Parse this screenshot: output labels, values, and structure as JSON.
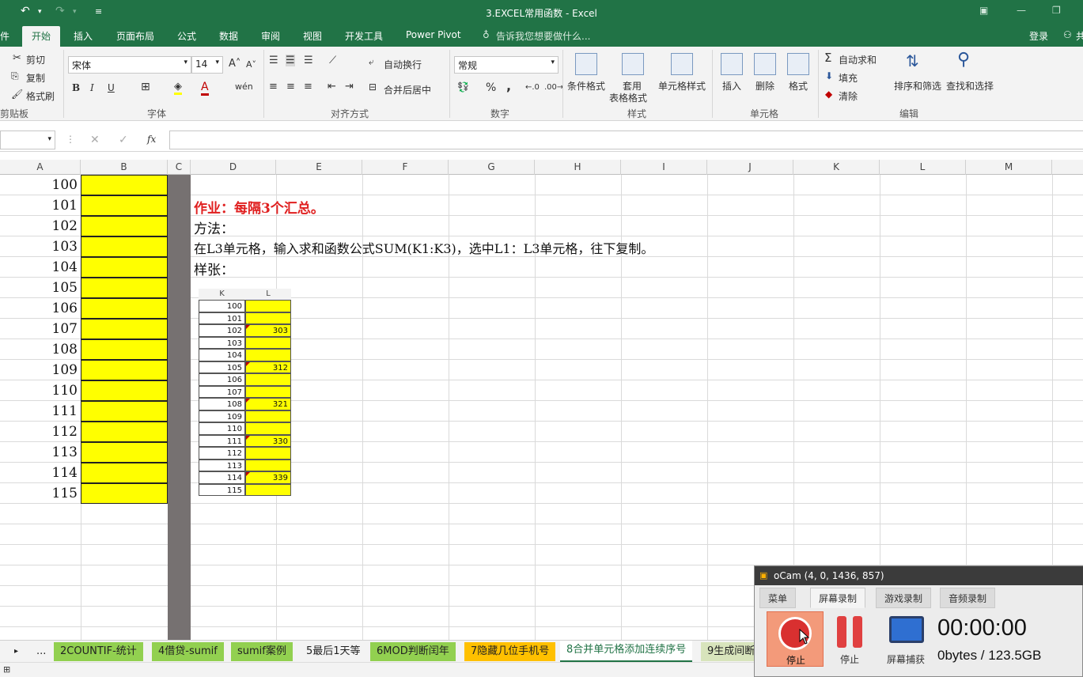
{
  "titlebar": {
    "title": "3.EXCEL常用函数 - Excel"
  },
  "menu": {
    "file": "件",
    "home": "开始",
    "insert": "插入",
    "layout": "页面布局",
    "formulas": "公式",
    "data": "数据",
    "review": "审阅",
    "view": "视图",
    "developer": "开发工具",
    "powerpivot": "Power Pivot",
    "tellme": "告诉我您想要做什么...",
    "login": "登录",
    "share": "共"
  },
  "ribbon": {
    "clipboard": {
      "cut": "剪切",
      "copy": "复制",
      "painter": "格式刷",
      "label": "剪贴板"
    },
    "font": {
      "name": "宋体",
      "size": "14",
      "bold": "B",
      "italic": "I",
      "underline": "U",
      "label": "字体"
    },
    "align": {
      "wrap": "自动换行",
      "merge": "合并后居中",
      "label": "对齐方式"
    },
    "number": {
      "format": "常规",
      "percent": "%",
      "comma": ",",
      "label": "数字"
    },
    "styles": {
      "cond": "条件格式",
      "table1": "套用",
      "table2": "表格格式",
      "cell": "单元格样式",
      "label": "样式"
    },
    "cells": {
      "insert": "插入",
      "delete": "删除",
      "format": "格式",
      "label": "单元格"
    },
    "edit": {
      "autosum": "自动求和",
      "fill": "填充",
      "clear": "清除",
      "sort": "排序和筛选",
      "find": "查找和选择",
      "label": "编辑"
    }
  },
  "formula": {
    "namebox": "",
    "fx": "fx",
    "cancel": "✕",
    "enter": "✓"
  },
  "columns": [
    "A",
    "B",
    "C",
    "D",
    "E",
    "F",
    "G",
    "H",
    "I",
    "J",
    "K",
    "L",
    "M"
  ],
  "colA": [
    "100",
    "101",
    "102",
    "103",
    "104",
    "105",
    "106",
    "107",
    "108",
    "109",
    "110",
    "111",
    "112",
    "113",
    "114",
    "115"
  ],
  "text": {
    "homework": "作业：每隔3个汇总。",
    "method": "方法：",
    "instr": "在L3单元格，输入求和函数公式SUM(K1:K3)，选中L1：L3单元格，往下复制。",
    "sample": "样张："
  },
  "sample": {
    "hk": "K",
    "hl": "L",
    "k": [
      "100",
      "101",
      "102",
      "103",
      "104",
      "105",
      "106",
      "107",
      "108",
      "109",
      "110",
      "111",
      "112",
      "113",
      "114",
      "115"
    ],
    "l": [
      "",
      "",
      "303",
      "",
      "",
      "312",
      "",
      "",
      "321",
      "",
      "",
      "330",
      "",
      "",
      "339",
      ""
    ]
  },
  "sheets": [
    "2COUNTIF-统计",
    "4借贷-sumif",
    "sumif案例",
    "5最后1天等",
    "6MOD判断闰年",
    "7隐藏几位手机号",
    "8合并单元格添加连续序号",
    "9生成间断"
  ],
  "sheet_more": "...",
  "ocam": {
    "title": "oCam (4, 0, 1436, 857)",
    "tabs": [
      "菜单",
      "屏幕录制",
      "游戏录制",
      "音频录制"
    ],
    "stop": "停止",
    "pause": "停止",
    "capture": "屏幕捕获",
    "time": "00:00:00",
    "size": "0bytes / 123.5GB"
  }
}
